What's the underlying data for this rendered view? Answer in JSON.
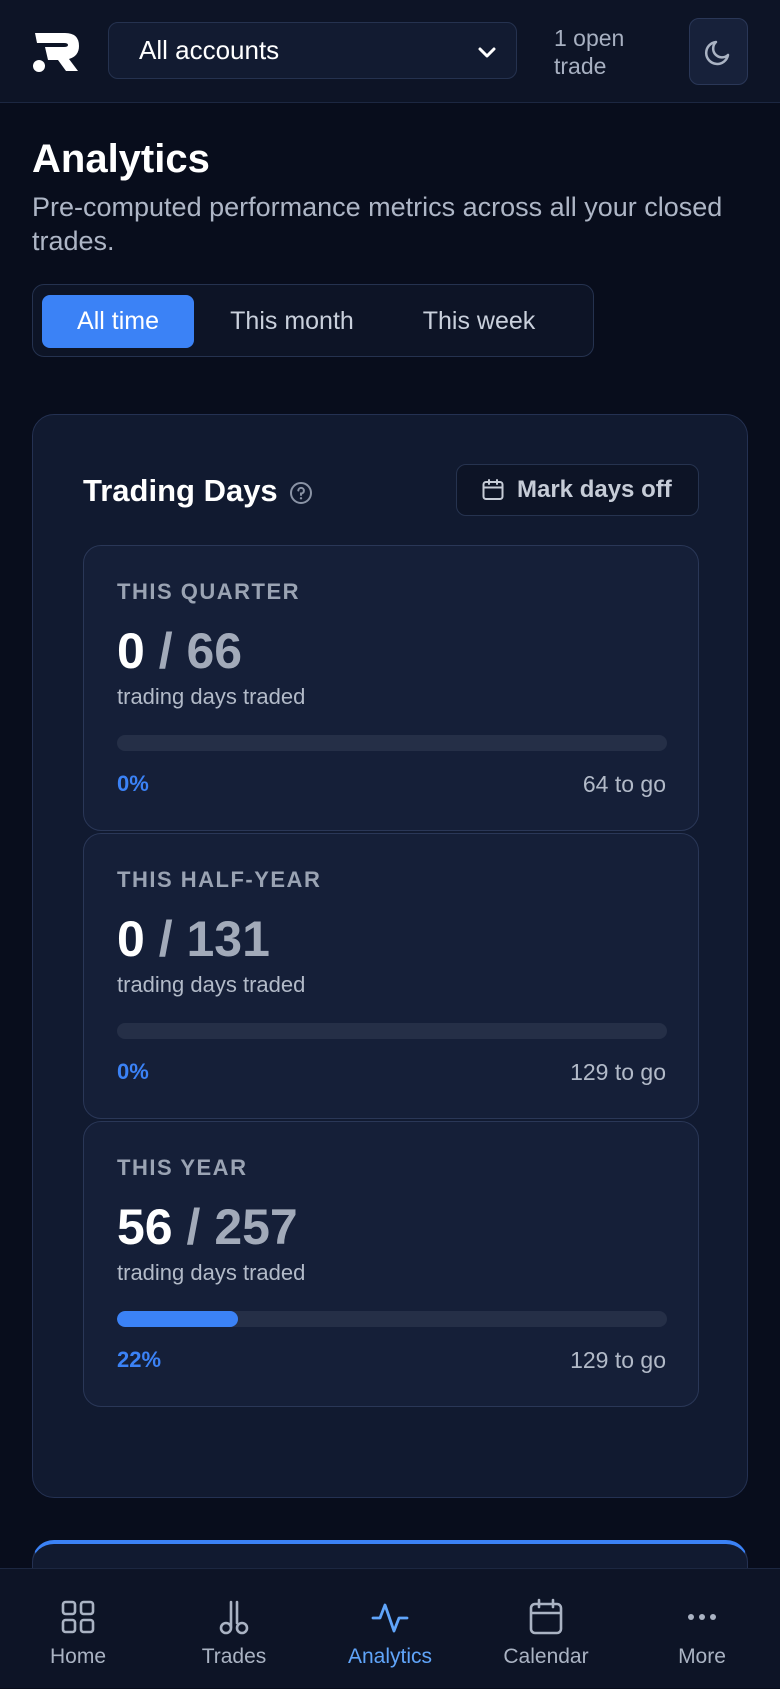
{
  "header": {
    "logo_icon": "app-logo",
    "account_select_value": "All accounts",
    "open_trade_text": "1 open trade",
    "theme_toggle_icon": "moon-icon"
  },
  "page": {
    "title": "Analytics",
    "subtitle": "Pre-computed performance metrics across all your closed trades."
  },
  "range_tabs": [
    {
      "label": "All time",
      "active": true
    },
    {
      "label": "This month",
      "active": false
    },
    {
      "label": "This week",
      "active": false
    }
  ],
  "trading_days": {
    "title": "Trading Days",
    "help_icon": "question-circle-icon",
    "mark_days_off_label": "Mark days off",
    "caption": "trading days traded",
    "periods": [
      {
        "label": "THIS QUARTER",
        "traded": "0",
        "total": "66",
        "percent_label": "0%",
        "progress": 0,
        "to_go": "64 to go"
      },
      {
        "label": "THIS HALF-YEAR",
        "traded": "0",
        "total": "131",
        "percent_label": "0%",
        "progress": 0,
        "to_go": "129 to go"
      },
      {
        "label": "THIS YEAR",
        "traded": "56",
        "total": "257",
        "percent_label": "22%",
        "progress": 0.22,
        "to_go": "129 to go"
      }
    ]
  },
  "bottom_nav": [
    {
      "label": "Home",
      "icon": "grid-icon",
      "active": false
    },
    {
      "label": "Trades",
      "icon": "trades-icon",
      "active": false
    },
    {
      "label": "Analytics",
      "icon": "activity-icon",
      "active": true
    },
    {
      "label": "Calendar",
      "icon": "calendar-icon",
      "active": false
    },
    {
      "label": "More",
      "icon": "more-icon",
      "active": false
    }
  ],
  "colors": {
    "accent": "#3b82f6",
    "background": "#080d1c",
    "card": "#111a30"
  }
}
